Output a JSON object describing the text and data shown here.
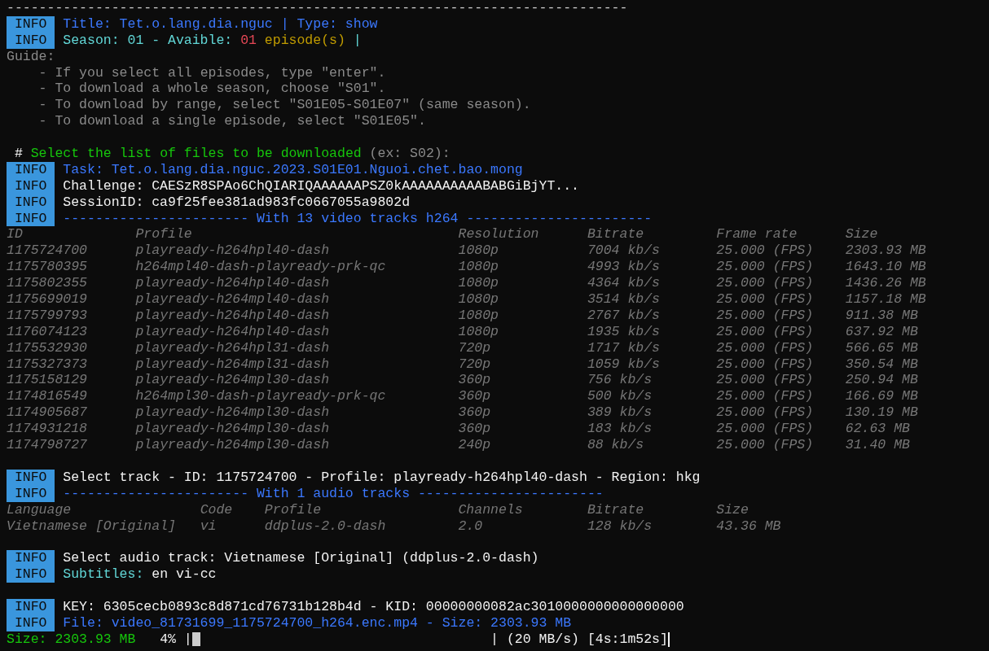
{
  "lines": [
    {
      "kind": "rule",
      "text": "-----------------------------------------------------------------------------"
    },
    {
      "kind": "info",
      "label": "INFO",
      "segments": [
        {
          "text": "Title: Tet.o.lang.dia.nguc | Type: show",
          "color": "#3b78ff"
        }
      ]
    },
    {
      "kind": "info",
      "label": "INFO",
      "segments": [
        {
          "text": "Season: 01 - Avaible: ",
          "color": "#61d6d6"
        },
        {
          "text": "01",
          "color": "#e74856"
        },
        {
          "text": " episode(s)",
          "color": "#c19c00"
        },
        {
          "text": " |",
          "color": "#61d6d6"
        }
      ]
    },
    {
      "kind": "plain",
      "segments": [
        {
          "text": "Guide:",
          "color": "#8a8a8a"
        }
      ]
    },
    {
      "kind": "plain",
      "segments": [
        {
          "text": "    - If you select all episodes, type \"enter\".",
          "color": "#8a8a8a"
        }
      ]
    },
    {
      "kind": "plain",
      "segments": [
        {
          "text": "    - To download a whole season, choose \"S01\".",
          "color": "#8a8a8a"
        }
      ]
    },
    {
      "kind": "plain",
      "segments": [
        {
          "text": "    - To download by range, select \"S01E05-S01E07\" (same season).",
          "color": "#8a8a8a"
        }
      ]
    },
    {
      "kind": "plain",
      "segments": [
        {
          "text": "    - To download a single episode, select \"S01E05\".",
          "color": "#8a8a8a"
        }
      ]
    },
    {
      "kind": "blank"
    },
    {
      "kind": "plain",
      "segments": [
        {
          "text": " #",
          "color": "#f2f2f2"
        },
        {
          "text": " Select the list of files to be downloaded",
          "color": "#16c60c"
        },
        {
          "text": " (ex: S02):",
          "color": "#8a8a8a"
        }
      ]
    },
    {
      "kind": "info",
      "label": "INFO",
      "segments": [
        {
          "text": "Task: Tet.o.lang.dia.nguc.2023.S01E01.Nguoi.chet.bao.mong",
          "color": "#3b78ff"
        }
      ]
    },
    {
      "kind": "info",
      "label": "INFO",
      "segments": [
        {
          "text": "Challenge: CAESzR8SPAo6ChQIARIQAAAAAAPSZ0kAAAAAAAAAABABGiBjYT...",
          "color": "#f2f2f2"
        }
      ]
    },
    {
      "kind": "info",
      "label": "INFO",
      "segments": [
        {
          "text": "SessionID: ca9f25fee381ad983fc0667055a9802d",
          "color": "#f2f2f2"
        }
      ]
    },
    {
      "kind": "info",
      "label": "INFO",
      "segments": [
        {
          "text": "----------------------- With 13 video tracks h264 -----------------------",
          "color": "#3b78ff"
        }
      ]
    },
    {
      "kind": "table",
      "columns": [
        "ID",
        "Profile",
        "Resolution",
        "Bitrate",
        "Frame rate",
        "Size"
      ],
      "rows": [
        [
          "1175724700",
          "playready-h264hpl40-dash",
          "1080p",
          "7004 kb/s",
          "25.000 (FPS)",
          "2303.93 MB"
        ],
        [
          "1175780395",
          "h264mpl40-dash-playready-prk-qc",
          "1080p",
          "4993 kb/s",
          "25.000 (FPS)",
          "1643.10 MB"
        ],
        [
          "1175802355",
          "playready-h264hpl40-dash",
          "1080p",
          "4364 kb/s",
          "25.000 (FPS)",
          "1436.26 MB"
        ],
        [
          "1175699019",
          "playready-h264mpl40-dash",
          "1080p",
          "3514 kb/s",
          "25.000 (FPS)",
          "1157.18 MB"
        ],
        [
          "1175799793",
          "playready-h264hpl40-dash",
          "1080p",
          "2767 kb/s",
          "25.000 (FPS)",
          "911.38 MB"
        ],
        [
          "1176074123",
          "playready-h264hpl40-dash",
          "1080p",
          "1935 kb/s",
          "25.000 (FPS)",
          "637.92 MB"
        ],
        [
          "1175532930",
          "playready-h264hpl31-dash",
          "720p",
          "1717 kb/s",
          "25.000 (FPS)",
          "566.65 MB"
        ],
        [
          "1175327373",
          "playready-h264mpl31-dash",
          "720p",
          "1059 kb/s",
          "25.000 (FPS)",
          "350.54 MB"
        ],
        [
          "1175158129",
          "playready-h264mpl30-dash",
          "360p",
          "756 kb/s",
          "25.000 (FPS)",
          "250.94 MB"
        ],
        [
          "1174816549",
          "h264mpl30-dash-playready-prk-qc",
          "360p",
          "500 kb/s",
          "25.000 (FPS)",
          "166.69 MB"
        ],
        [
          "1174905687",
          "playready-h264mpl30-dash",
          "360p",
          "389 kb/s",
          "25.000 (FPS)",
          "130.19 MB"
        ],
        [
          "1174931218",
          "playready-h264mpl30-dash",
          "360p",
          "183 kb/s",
          "25.000 (FPS)",
          "62.63 MB"
        ],
        [
          "1174798727",
          "playready-h264mpl30-dash",
          "240p",
          "88 kb/s",
          "25.000 (FPS)",
          "31.40 MB"
        ]
      ]
    },
    {
      "kind": "blank"
    },
    {
      "kind": "info",
      "label": "INFO",
      "segments": [
        {
          "text": "Select track - ID: 1175724700 - Profile: playready-h264hpl40-dash - Region: hkg",
          "color": "#f2f2f2"
        }
      ]
    },
    {
      "kind": "info",
      "label": "INFO",
      "segments": [
        {
          "text": "----------------------- With 1 audio tracks -----------------------",
          "color": "#3b78ff"
        }
      ]
    },
    {
      "kind": "table",
      "columns": [
        "Language",
        "Code",
        "Profile",
        "Channels",
        "Bitrate",
        "Size"
      ],
      "rows": [
        [
          "Vietnamese [Original]",
          "vi",
          "ddplus-2.0-dash",
          "2.0",
          "128 kb/s",
          "43.36 MB"
        ]
      ]
    },
    {
      "kind": "blank"
    },
    {
      "kind": "info",
      "label": "INFO",
      "segments": [
        {
          "text": "Select audio track: Vietnamese [Original] (ddplus-2.0-dash)",
          "color": "#f2f2f2"
        }
      ]
    },
    {
      "kind": "info",
      "label": "INFO",
      "segments": [
        {
          "text": "Subtitles:",
          "color": "#61d6d6"
        },
        {
          "text": " en vi-cc",
          "color": "#f2f2f2"
        }
      ]
    },
    {
      "kind": "blank"
    },
    {
      "kind": "info",
      "label": "INFO",
      "segments": [
        {
          "text": "KEY: 6305cecb0893c8d871cd76731b128b4d - KID: 00000000082ac3010000000000000000",
          "color": "#f2f2f2"
        }
      ]
    },
    {
      "kind": "info",
      "label": "INFO",
      "segments": [
        {
          "text": "File: video_81731699_1175724700_h264.enc.mp4 - Size: 2303.93 MB",
          "color": "#3b78ff"
        }
      ]
    },
    {
      "kind": "progress",
      "size": "Size: 2303.93 MB",
      "percent": "4%",
      "left_edge": "|",
      "right_edge": "|",
      "rate": "(20 MB/s) [4s:1m52s]"
    }
  ]
}
